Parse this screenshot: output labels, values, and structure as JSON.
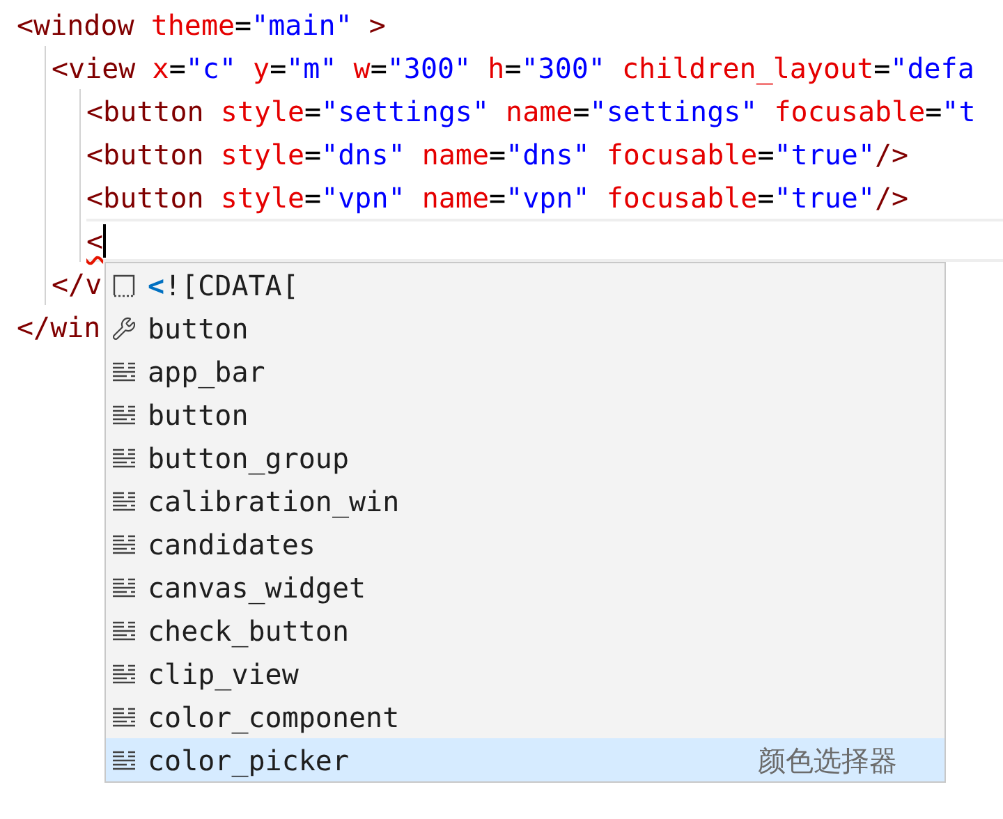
{
  "editor": {
    "lines": [
      {
        "tokens": [
          {
            "text": "<window",
            "kind": "tag"
          },
          {
            "text": " theme",
            "kind": "attr"
          },
          {
            "text": "=",
            "kind": "op"
          },
          {
            "text": "\"main\"",
            "kind": "string"
          },
          {
            "text": " >",
            "kind": "tag"
          }
        ],
        "current": false,
        "children": [
          {
            "tokens": [
              {
                "text": "<view",
                "kind": "tag"
              },
              {
                "text": " x",
                "kind": "attr"
              },
              {
                "text": "=",
                "kind": "op"
              },
              {
                "text": "\"c\"",
                "kind": "string"
              },
              {
                "text": " y",
                "kind": "attr"
              },
              {
                "text": "=",
                "kind": "op"
              },
              {
                "text": "\"m\"",
                "kind": "string"
              },
              {
                "text": " w",
                "kind": "attr"
              },
              {
                "text": "=",
                "kind": "op"
              },
              {
                "text": "\"300\"",
                "kind": "string"
              },
              {
                "text": " h",
                "kind": "attr"
              },
              {
                "text": "=",
                "kind": "op"
              },
              {
                "text": "\"300\"",
                "kind": "string"
              },
              {
                "text": " children_layout",
                "kind": "attr"
              },
              {
                "text": "=",
                "kind": "op"
              },
              {
                "text": "\"defa",
                "kind": "string"
              }
            ],
            "current": false,
            "children": [
              {
                "tokens": [
                  {
                    "text": "<button",
                    "kind": "tag"
                  },
                  {
                    "text": " style",
                    "kind": "attr"
                  },
                  {
                    "text": "=",
                    "kind": "op"
                  },
                  {
                    "text": "\"settings\"",
                    "kind": "string"
                  },
                  {
                    "text": " name",
                    "kind": "attr"
                  },
                  {
                    "text": "=",
                    "kind": "op"
                  },
                  {
                    "text": "\"settings\"",
                    "kind": "string"
                  },
                  {
                    "text": " focusable",
                    "kind": "attr"
                  },
                  {
                    "text": "=",
                    "kind": "op"
                  },
                  {
                    "text": "\"t",
                    "kind": "string"
                  }
                ],
                "current": false
              },
              {
                "tokens": [
                  {
                    "text": "<button",
                    "kind": "tag"
                  },
                  {
                    "text": " style",
                    "kind": "attr"
                  },
                  {
                    "text": "=",
                    "kind": "op"
                  },
                  {
                    "text": "\"dns\"",
                    "kind": "string"
                  },
                  {
                    "text": " name",
                    "kind": "attr"
                  },
                  {
                    "text": "=",
                    "kind": "op"
                  },
                  {
                    "text": "\"dns\"",
                    "kind": "string"
                  },
                  {
                    "text": " focusable",
                    "kind": "attr"
                  },
                  {
                    "text": "=",
                    "kind": "op"
                  },
                  {
                    "text": "\"true\"",
                    "kind": "string"
                  },
                  {
                    "text": "/>",
                    "kind": "tag"
                  }
                ],
                "current": false
              },
              {
                "tokens": [
                  {
                    "text": "<button",
                    "kind": "tag"
                  },
                  {
                    "text": " style",
                    "kind": "attr"
                  },
                  {
                    "text": "=",
                    "kind": "op"
                  },
                  {
                    "text": "\"vpn\"",
                    "kind": "string"
                  },
                  {
                    "text": " name",
                    "kind": "attr"
                  },
                  {
                    "text": "=",
                    "kind": "op"
                  },
                  {
                    "text": "\"vpn\"",
                    "kind": "string"
                  },
                  {
                    "text": " focusable",
                    "kind": "attr"
                  },
                  {
                    "text": "=",
                    "kind": "op"
                  },
                  {
                    "text": "\"true\"",
                    "kind": "string"
                  },
                  {
                    "text": "/>",
                    "kind": "tag"
                  }
                ],
                "current": false
              },
              {
                "tokens": [
                  {
                    "text": "<",
                    "kind": "tag",
                    "error": true
                  }
                ],
                "current": true
              }
            ]
          },
          {
            "tokens": [
              {
                "text": "</v",
                "kind": "tag"
              }
            ],
            "current": false
          }
        ]
      },
      {
        "tokens": [
          {
            "text": "</win",
            "kind": "tag"
          }
        ],
        "current": false
      }
    ]
  },
  "suggestions": [
    {
      "kind": "snippet",
      "prefix": "<",
      "label": "![CDATA[",
      "selected": false
    },
    {
      "kind": "keyword",
      "label": "button",
      "selected": false
    },
    {
      "kind": "text",
      "label": "app_bar",
      "selected": false
    },
    {
      "kind": "text",
      "label": "button",
      "selected": false
    },
    {
      "kind": "text",
      "label": "button_group",
      "selected": false
    },
    {
      "kind": "text",
      "label": "calibration_win",
      "selected": false
    },
    {
      "kind": "text",
      "label": "candidates",
      "selected": false
    },
    {
      "kind": "text",
      "label": "canvas_widget",
      "selected": false
    },
    {
      "kind": "text",
      "label": "check_button",
      "selected": false
    },
    {
      "kind": "text",
      "label": "clip_view",
      "selected": false
    },
    {
      "kind": "text",
      "label": "color_component",
      "selected": false
    },
    {
      "kind": "text",
      "label": "color_picker",
      "selected": true,
      "detail": "颜色选择器"
    }
  ]
}
